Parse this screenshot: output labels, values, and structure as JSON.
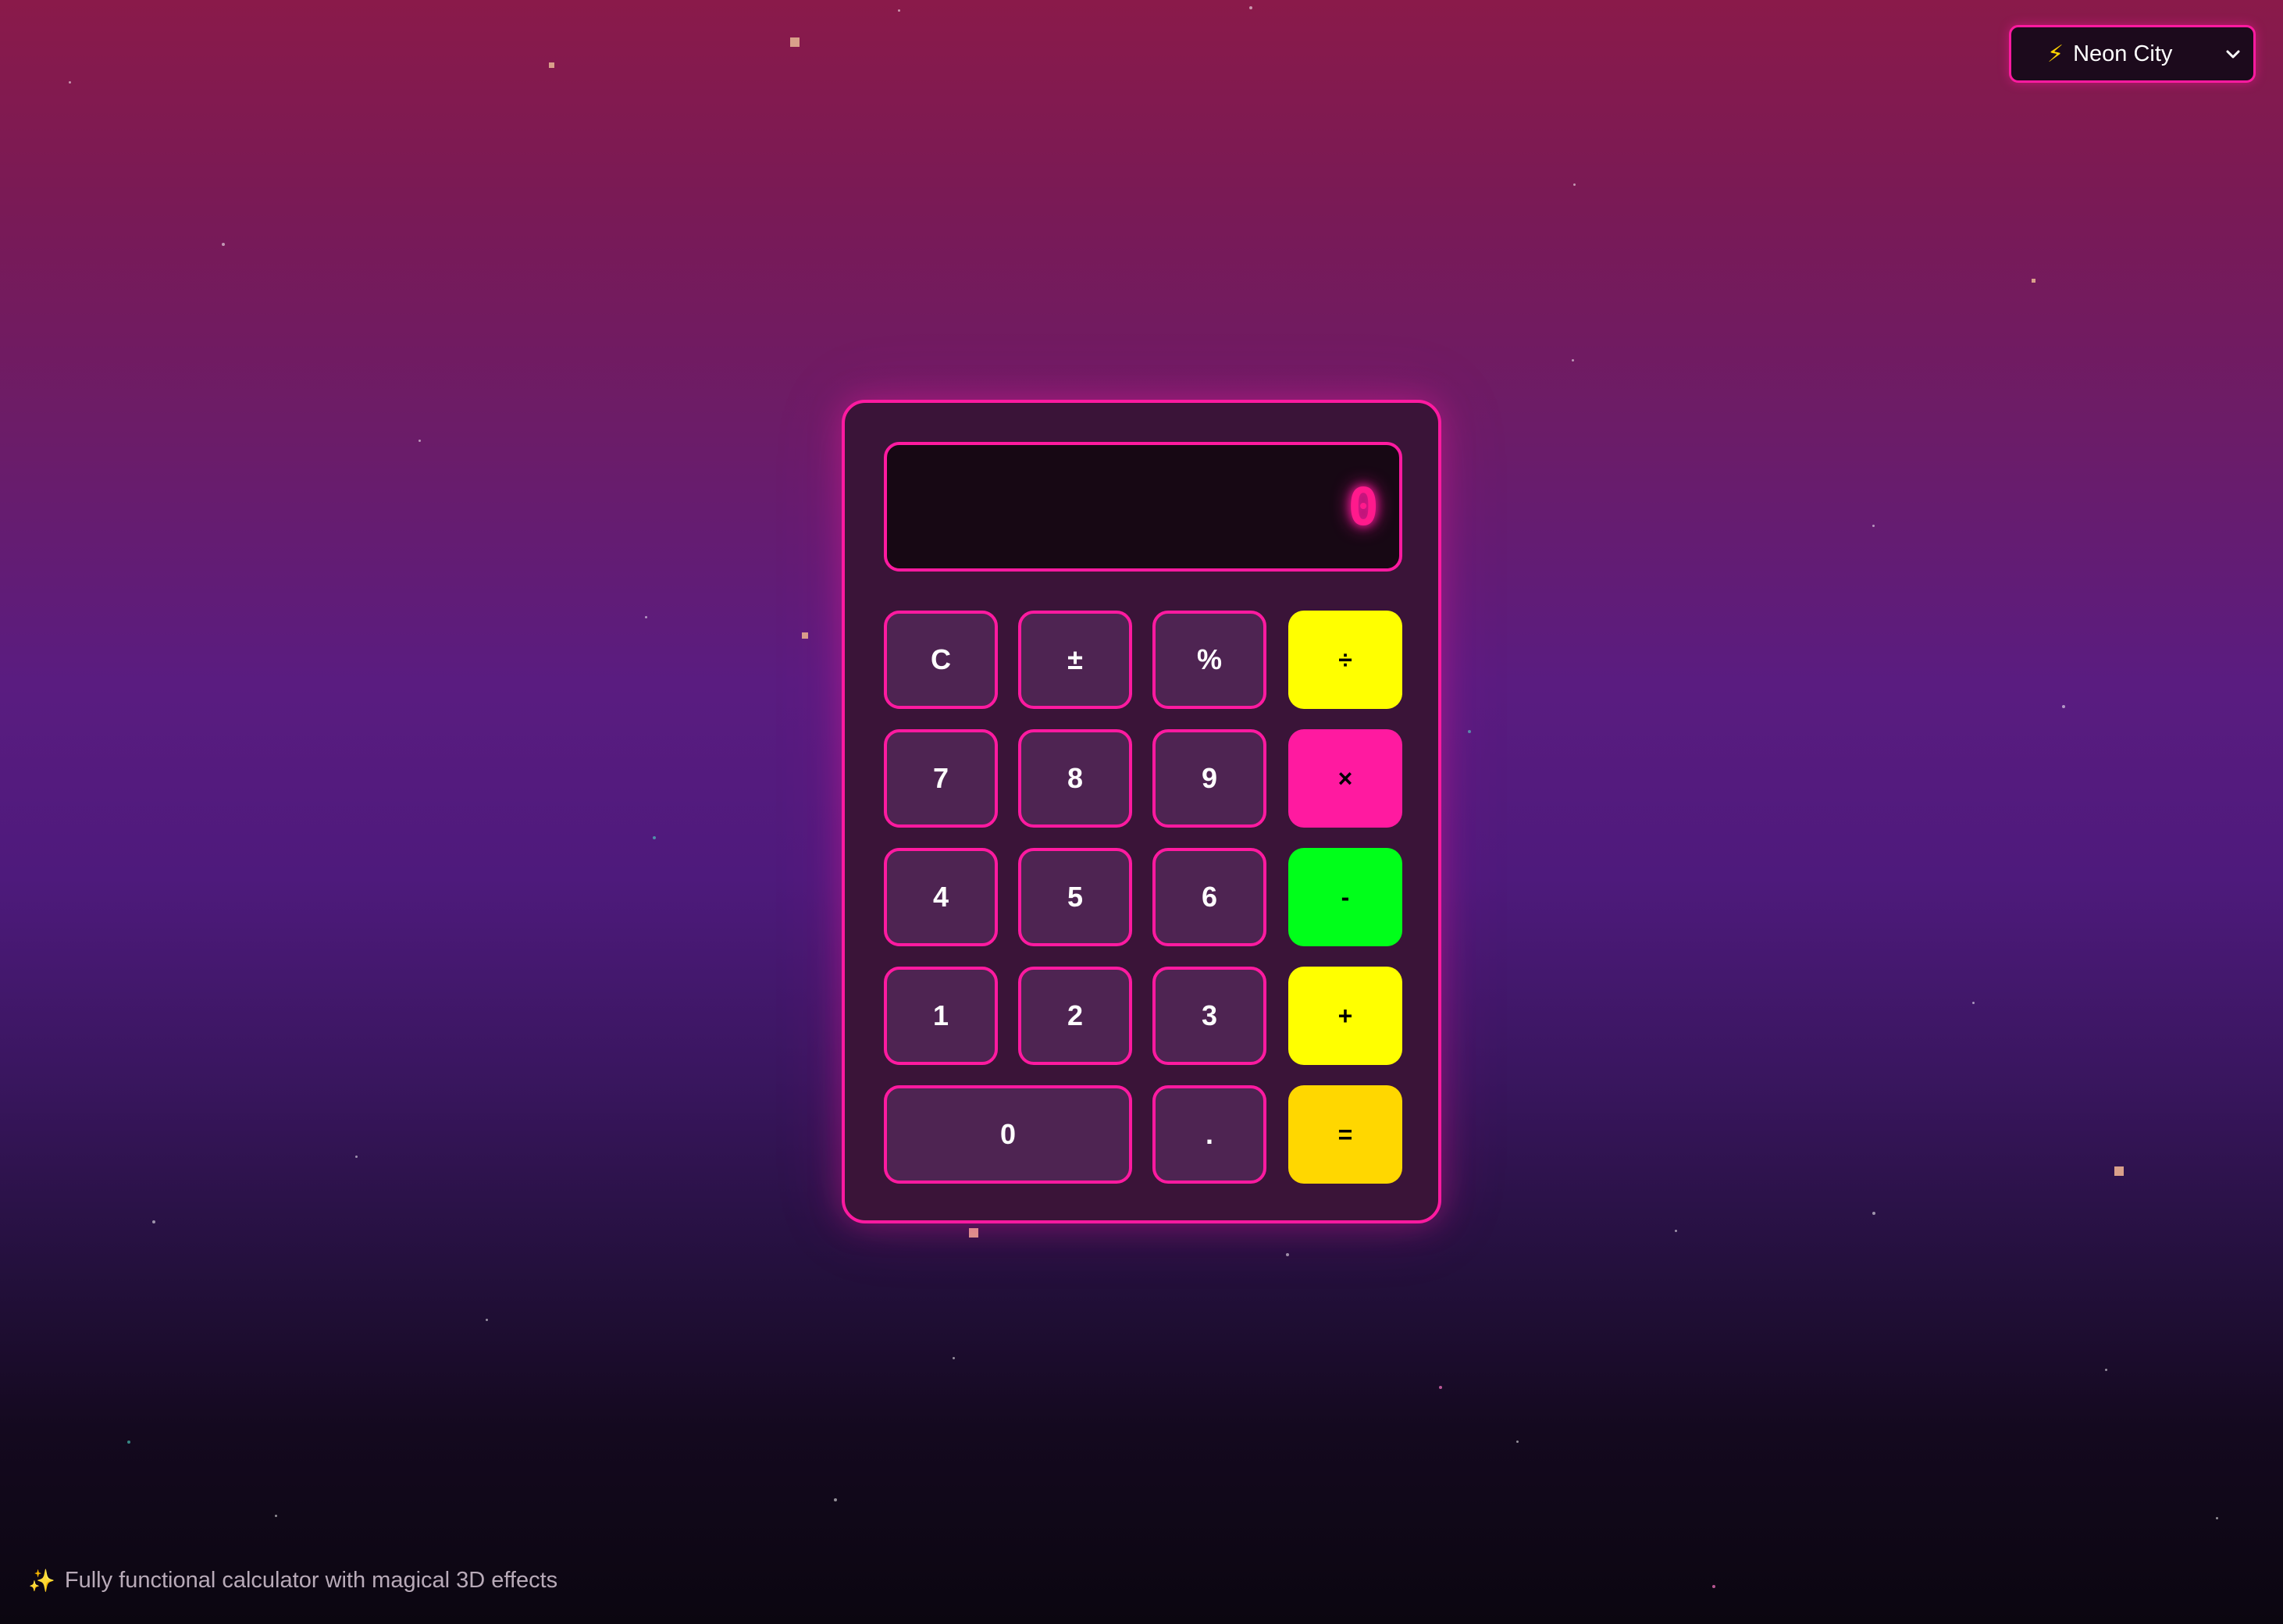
{
  "theme_selector": {
    "icon": "lightning-bolt-icon",
    "selected": "Neon City"
  },
  "calculator": {
    "display_value": "0",
    "keys": {
      "clear": "C",
      "plus_minus": "±",
      "percent": "%",
      "divide": "÷",
      "seven": "7",
      "eight": "8",
      "nine": "9",
      "multiply": "×",
      "four": "4",
      "five": "5",
      "six": "6",
      "subtract": "-",
      "one": "1",
      "two": "2",
      "three": "3",
      "add": "+",
      "zero": "0",
      "decimal": ".",
      "equals": "="
    },
    "colors": {
      "accent": "#ff1aa0",
      "divide": "#ffff00",
      "multiply": "#ff1aa0",
      "subtract": "#00ff1a",
      "add": "#ffff00",
      "equals": "#ffd700"
    }
  },
  "footer": {
    "icon": "sparkles-icon",
    "text": "Fully functional calculator with magical 3D effects"
  }
}
